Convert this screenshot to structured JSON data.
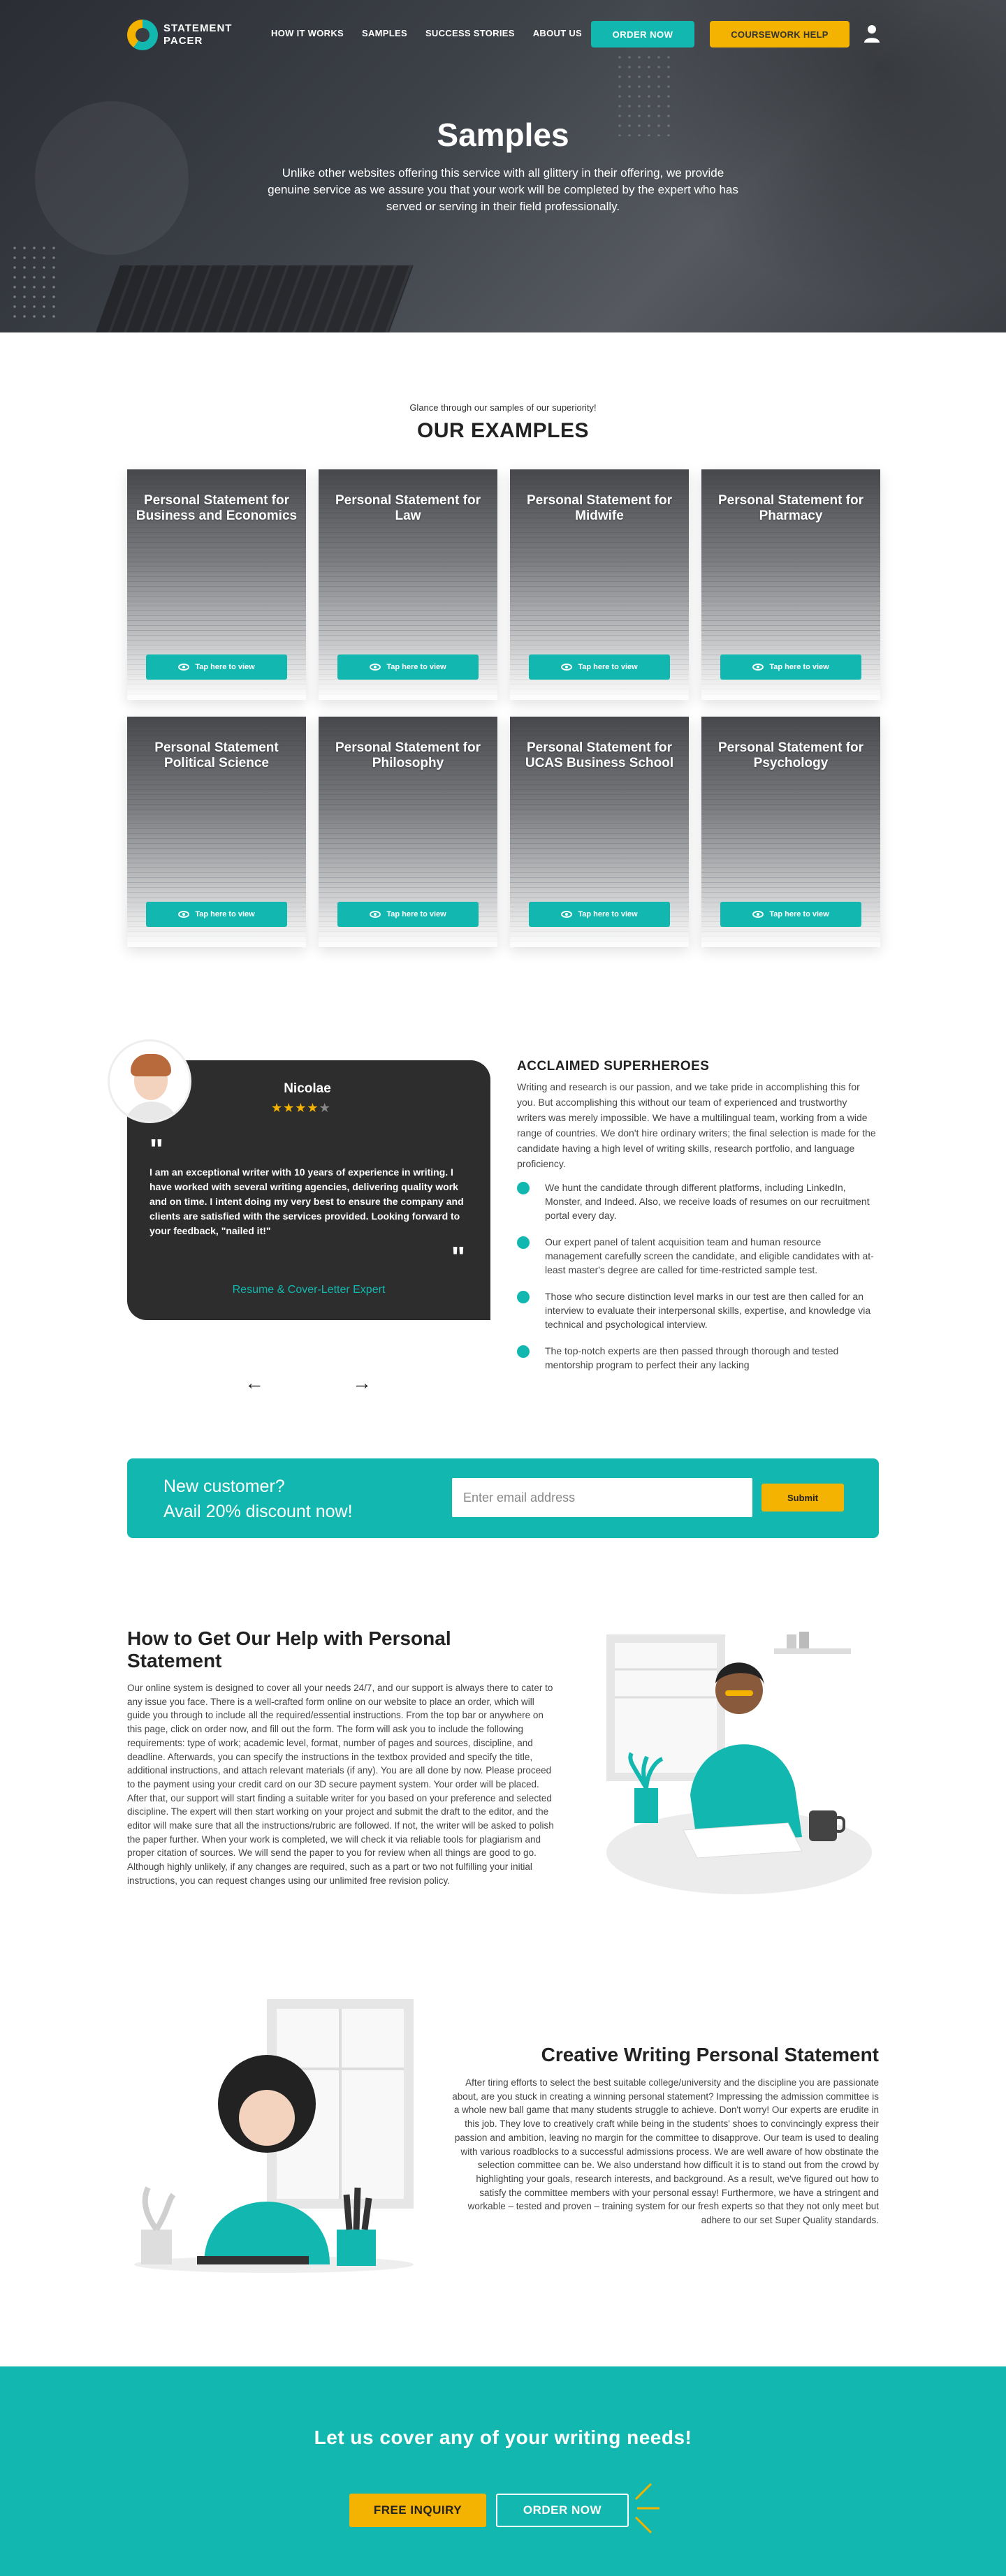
{
  "nav": {
    "logo_line1": "STATEMENT",
    "logo_line2": "PACER",
    "links": [
      "HOW IT WORKS",
      "SAMPLES",
      "SUCCESS STORIES",
      "ABOUT US"
    ],
    "order_label": "ORDER NOW",
    "coursework_label": "COURSEWORK HELP",
    "user_icon": "user-icon"
  },
  "hero": {
    "title": "Samples",
    "subtitle": "Unlike other websites offering this service with all glittery in their offering, we provide genuine service as we assure you that your work will be completed by the expert who has served or serving in their field professionally."
  },
  "examples": {
    "kicker": "Glance through our samples of our superiority!",
    "title": "OUR EXAMPLES",
    "button_label": "Tap here to view",
    "cards": [
      "Personal Statement for Business and Economics",
      "Personal Statement for Law",
      "Personal Statement for Midwife",
      "Personal Statement for Pharmacy",
      "Personal Statement Political Science",
      "Personal Statement for Philosophy",
      "Personal Statement for UCAS Business School",
      "Personal Statement for Psychology"
    ]
  },
  "testimonial": {
    "name": "Nicolae",
    "rating": 4,
    "rating_max": 5,
    "quote": "I am an exceptional writer with 10 years of experience in writing. I have worked with several writing agencies, delivering quality work and on time. I intent doing my very best to ensure the company and clients are satisfied with the services provided. Looking forward to your feedback, \"nailed it!\"",
    "role": "Resume & Cover-Letter Expert",
    "prev_icon": "arrow-left-icon",
    "next_icon": "arrow-right-icon"
  },
  "acclaimed": {
    "title": "ACCLAIMED SUPERHEROES",
    "intro": "Writing and research is our passion, and we take pride in accomplishing this for you. But accomplishing this without our team of experienced and trustworthy writers was merely impossible. We have a multilingual team, working from a wide range of countries. We don't hire ordinary writers; the final selection is made for the candidate having a high level of writing skills, research portfolio, and language proficiency.",
    "points": [
      "We hunt the candidate through different platforms, including LinkedIn, Monster, and Indeed. Also, we receive loads of resumes on our recruitment portal every day.",
      "Our expert panel of talent acquisition team and human resource management carefully screen the candidate, and eligible candidates with at-least master's degree are called for time-restricted sample test.",
      "Those who secure distinction level marks in our test are then called for an interview to evaluate their interpersonal skills, expertise, and knowledge via technical and psychological interview.",
      "The top-notch experts are then passed through thorough and tested mentorship program to perfect their any lacking"
    ]
  },
  "promo": {
    "line1": "New customer?",
    "line2": "Avail 20% discount now!",
    "email_placeholder": "Enter email address",
    "submit_label": "Submit"
  },
  "how": {
    "title": "How to Get Our Help with Personal Statement",
    "text": "Our online system is designed to cover all your needs 24/7, and our support is always there to cater to any issue you face. There is a well-crafted form online on our website to place an order, which will guide you through to include all the required/essential instructions. From the top bar or anywhere on this page, click on order now, and fill out the form. The form will ask you to include the following requirements: type of work; academic level, format, number of pages and sources, discipline, and deadline. Afterwards, you can specify the instructions in the textbox provided and specify the title, additional instructions, and attach relevant materials (if any). You are all done by now. Please proceed to the payment using your credit card on our 3D secure payment system. Your order will be placed. After that, our support will start finding a suitable writer for you based on your preference and selected discipline. The expert will then start working on your project and submit the draft to the editor, and the editor will make sure that all the instructions/rubric are followed. If not, the writer will be asked to polish the paper further. When your work is completed, we will check it via reliable tools for plagiarism and proper citation of sources. We will send the paper to you for review when all things are good to go. Although highly unlikely, if any changes are required, such as a part or two not fulfilling your initial instructions, you can request changes using our unlimited free revision policy."
  },
  "creative": {
    "title": "Creative Writing Personal Statement",
    "text": "After tiring efforts to select the best suitable college/university and the discipline you are passionate about, are you stuck in creating a winning personal statement? Impressing the admission committee is a whole new ball game that many students struggle to achieve. Don't worry! Our experts are erudite in this job. They love to creatively craft while being in the students' shoes to convincingly express their passion and ambition, leaving no margin for the committee to disapprove. Our team is used to dealing with various roadblocks to a successful admissions process. We are well aware of how obstinate the selection committee can be. We also understand how difficult it is to stand out from the crowd by highlighting your goals, research interests, and background. As a result, we've figured out how to satisfy the committee members with your personal essay! Furthermore, we have a stringent and workable – tested and proven – training system for our fresh experts so that they not only meet but adhere to our set Super Quality standards."
  },
  "cta": {
    "title": "Let us cover any of your writing needs!",
    "inquiry_label": "FREE INQUIRY",
    "order_label": "ORDER NOW"
  },
  "colors": {
    "teal": "#12b8b0",
    "yellow": "#f5b301",
    "dark": "#2d2d2d"
  }
}
